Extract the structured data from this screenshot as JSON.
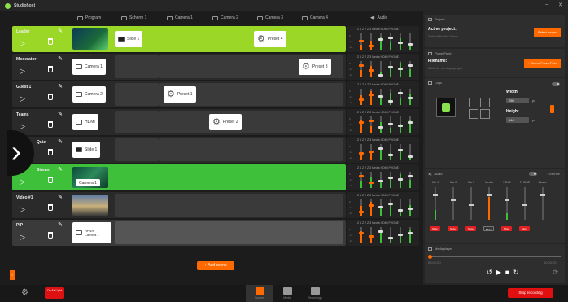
{
  "window": {
    "title": "Studiohost",
    "min": "–",
    "close": "✕"
  },
  "columns": [
    "Program",
    "Scherm 1",
    "Camera 1",
    "Camera 2",
    "Camera 3",
    "Camera 4",
    "Audio"
  ],
  "scenes": [
    {
      "name": "Leader",
      "state": "lime",
      "cards": [
        {
          "label": "Slide 1"
        },
        {
          "label": "Preset 4"
        }
      ]
    },
    {
      "name": "Moderator",
      "cards": [
        {
          "label": "Camera 1"
        },
        {
          "label": "Preset 3"
        }
      ]
    },
    {
      "name": "Guest 1",
      "cards": [
        {
          "label": "Camera 2"
        },
        {
          "label": "Preset 1"
        }
      ]
    },
    {
      "name": "Teams",
      "cards": [
        {
          "label": "HDMI"
        },
        {
          "label": "Preset 2"
        }
      ]
    },
    {
      "name": "Quiz",
      "cards": [
        {
          "label": "Slide 1"
        }
      ]
    },
    {
      "name": "Stream",
      "state": "green",
      "cards": [
        {
          "label": "Camera 1"
        }
      ]
    },
    {
      "name": "Video #1",
      "cards": []
    },
    {
      "name": "PiP",
      "cards": [
        {
          "label": "HPNH",
          "sub": "Camera 1"
        }
      ]
    }
  ],
  "mixer": {
    "labels": "Z 1  Z 2  Z 3  Media  HDMI PHONE",
    "db": [
      "0",
      "-12",
      "-24"
    ]
  },
  "add_scene": "+ Add scene",
  "side": {
    "project": {
      "header": "Project",
      "label": "Active project:",
      "value": "Default/Studio Demo",
      "button": "Select project"
    },
    "powerpoint": {
      "header": "PowerPoint",
      "label": "Filename:",
      "value": "Slide for on-display.pptx",
      "button": "+ Select PowerPoint"
    },
    "logo": {
      "header": "Logo",
      "width_label": "Width",
      "width_value": "250",
      "height_label": "Height",
      "height_value": "144",
      "unit": "px"
    },
    "audio": {
      "header": "Audio",
      "toggle_label": "Override",
      "channels": [
        "Mic 1",
        "Mic 2",
        "Mic 3",
        "Media",
        "HDMI",
        "PHONE",
        "Master"
      ],
      "mute": "Mute",
      "meter_levels": [
        0.3,
        0,
        0,
        0.7,
        0.2,
        0,
        0
      ]
    },
    "mediaplayer": {
      "header": "Mediaplayer",
      "time_start": "00:00:00",
      "time_end": "00:00:00"
    }
  },
  "bottom": {
    "on_air": "On Air Light",
    "tabs": [
      "Scenes",
      "Media",
      "Recordings"
    ],
    "record": "Stop recording"
  },
  "colors": {
    "accent": "#ff6a00",
    "lime": "#9bd726",
    "green": "#3ec03a",
    "red": "#e01010"
  }
}
